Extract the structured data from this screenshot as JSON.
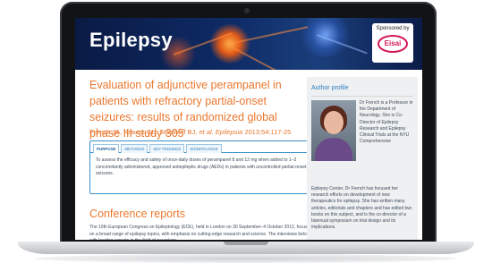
{
  "banner": {
    "journal_title": "Epilepsy",
    "sponsor_label": "Sponsored by",
    "sponsor_logo_text": "Eisai"
  },
  "article": {
    "title": "Evaluation of adjunctive perampanel in patients with refractory partial-onset seizures: results of randomized global phase III study 305",
    "authors": "French JA, Krauss GL, Steinhoff BJ,",
    "et_al": "et al.",
    "journal": "Epilepsia",
    "citation": "2013;54:117-25"
  },
  "abstract": {
    "tabs": [
      {
        "label": "PURPOSE",
        "active": true
      },
      {
        "label": "METHODS",
        "active": false
      },
      {
        "label": "KEY FINDINGS",
        "active": false
      },
      {
        "label": "SIGNIFICANCE",
        "active": false
      }
    ],
    "text": "To assess the efficacy and safety of once-daily doses of perampanel 8 and 12 mg when added to 1–3 concomitantly administered, approved antiepileptic drugs (AEDs) in patients with uncontrolled partial-onset seizures."
  },
  "conference": {
    "title": "Conference reports",
    "text": "The 10th European Congress on Epileptology (ECE), held in London on 30 September–4 October 2012, focused on a broad range of epilepsy topics, with emphasis on cutting-edge research and science. The interviews below, with leading experts in the field of neurology,"
  },
  "author_profile": {
    "heading": "Author profile",
    "bio_top": "Dr French is a Professor in the Department of Neurology. She is Co-Director of Epilepsy Research and Epilepsy Clinical Trials at the NYU Comprehensive",
    "bio_bottom": "Epilepsy Center. Dr French has focused her research efforts on development of new therapeutics for epilepsy. She has written many articles, editorials and chapters and has edited two books on this subject, and is the co-director of a biannual symposium on trial design and its implications."
  },
  "colors": {
    "accent_orange": "#e8772e",
    "link_blue": "#2f7dbb",
    "banner_navy": "#0e2b66",
    "sidebar_bg": "#eef0f2"
  }
}
